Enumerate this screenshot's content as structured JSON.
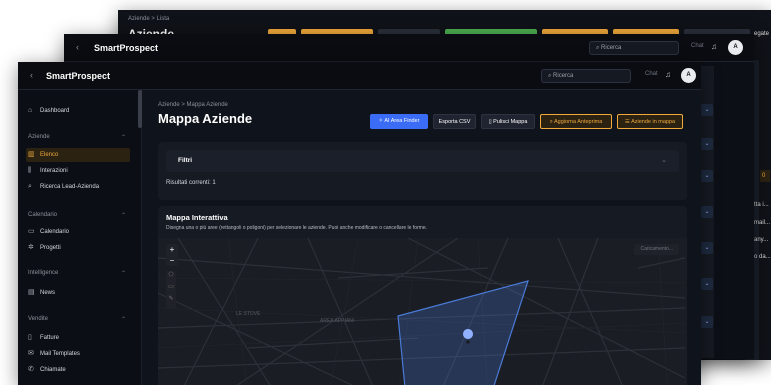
{
  "back_windows": {
    "win3": {
      "breadcrumb": "Aziende  >  Lista",
      "title": "Aziende",
      "button_colors": [
        "#f2a93b",
        "#f2a93b",
        "#2a2f3a",
        "#4caf50",
        "#f2a93b",
        "#f2a93b",
        "#2a2f3a"
      ],
      "clipped_right_text": [
        "egate",
        "0",
        "tta i...",
        "mail...",
        "any...",
        "o da..."
      ]
    },
    "win2": {
      "brand": "SmartProspect",
      "search_placeholder": "Ricerca",
      "chat": "Chat",
      "avatar": "A"
    }
  },
  "topbar": {
    "back_icon": "chevron-left-icon",
    "brand": "SmartProspect",
    "search_placeholder": "Ricerca",
    "chat": "Chat",
    "bell_icon": "bell-icon",
    "avatar": "A"
  },
  "sidebar": {
    "dashboard": "Dashboard",
    "sections": [
      {
        "label": "Aziende",
        "items": [
          "Elenco",
          "Interazioni",
          "Ricerca Lead-Azienda"
        ]
      },
      {
        "label": "Calendario",
        "items": [
          "Calendario",
          "Progetti"
        ]
      },
      {
        "label": "Intelligence",
        "items": [
          "News"
        ]
      },
      {
        "label": "Vendite",
        "items": [
          "Fatture",
          "Mail Templates",
          "Chiamate"
        ]
      }
    ],
    "active_item": "Elenco"
  },
  "main": {
    "breadcrumb": "Aziende  >  Mappa Aziende",
    "title": "Mappa Aziende",
    "buttons": [
      {
        "label": "AI Area Finder",
        "color": "#3b6cf6",
        "icon": "sparkle-icon"
      },
      {
        "label": "Esporta CSV",
        "color": "#1f2430",
        "icon": ""
      },
      {
        "label": "Pulisci Mappa",
        "color": "#1f2430",
        "icon": "trash-icon"
      },
      {
        "label": "Aggiorna Anteprima",
        "color": "#f2a93b",
        "icon": "search-icon"
      },
      {
        "label": "Aziende in mappa",
        "color": "#f2a93b",
        "icon": "list-icon"
      }
    ],
    "filters": {
      "label": "Filtri",
      "results": "Risultati correnti: 1"
    },
    "map": {
      "heading": "Mappa Interattiva",
      "description": "Disegna una o più aree (rettangoli o poligoni) per selezionare le aziende. Puoi anche modificare o cancellare le forme.",
      "loading": "Caricamento...",
      "labels": [
        "LE STOVE",
        "AREA APPIANI"
      ],
      "zoom_in": "+",
      "zoom_out": "−"
    }
  },
  "colors": {
    "accent": "#f2a93b",
    "blue": "#3b6cf6",
    "polygon": "#4a7bd8"
  }
}
